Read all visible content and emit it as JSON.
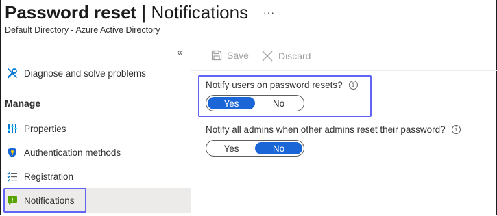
{
  "header": {
    "title_main": "Password reset",
    "title_separator": "|",
    "title_section": "Notifications",
    "more_label": "···",
    "subtitle": "Default Directory - Azure Active Directory"
  },
  "sidebar": {
    "collapse_label": "«",
    "items": [
      {
        "label": "Diagnose and solve problems",
        "icon": "wrench-icon"
      },
      {
        "label": "Properties",
        "icon": "properties-icon"
      },
      {
        "label": "Authentication methods",
        "icon": "shield-icon"
      },
      {
        "label": "Registration",
        "icon": "checklist-icon"
      },
      {
        "label": "Notifications",
        "icon": "notification-icon",
        "active": true
      }
    ],
    "section_label": "Manage"
  },
  "toolbar": {
    "save_label": "Save",
    "discard_label": "Discard"
  },
  "settings": {
    "notify_users": {
      "label": "Notify users on password resets?",
      "yes_label": "Yes",
      "no_label": "No",
      "selected": "Yes"
    },
    "notify_admins": {
      "label": "Notify all admins when other admins reset their password?",
      "yes_label": "Yes",
      "no_label": "No",
      "selected": "No"
    },
    "info_glyph": "i"
  },
  "colors": {
    "accent": "#1a66d6",
    "focus_outline": "#6264f4",
    "active_bg": "#edebe9"
  }
}
